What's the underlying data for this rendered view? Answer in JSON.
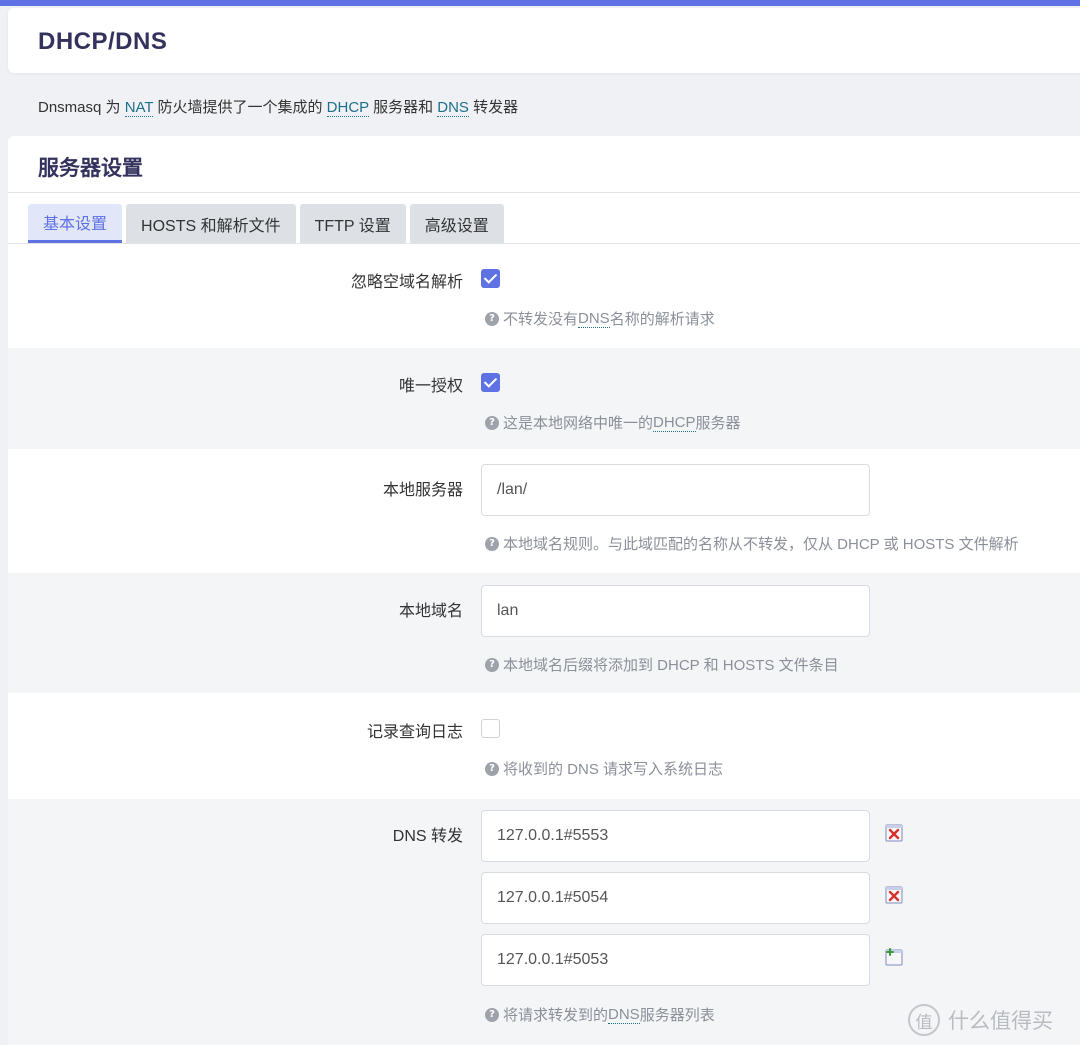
{
  "page": {
    "title": "DHCP/DNS",
    "description": {
      "p1": "Dnsmasq 为 ",
      "a1": "NAT",
      "p2": " 防火墙提供了一个集成的 ",
      "a2": "DHCP",
      "p3": " 服务器和 ",
      "a3": "DNS",
      "p4": " 转发器"
    }
  },
  "section": {
    "title": "服务器设置",
    "tabs": [
      {
        "label": "基本设置",
        "active": true
      },
      {
        "label": "HOSTS 和解析文件",
        "active": false
      },
      {
        "label": "TFTP 设置",
        "active": false
      },
      {
        "label": "高级设置",
        "active": false
      }
    ]
  },
  "fields": {
    "domainneeded": {
      "label": "忽略空域名解析",
      "checked": true,
      "help": {
        "p1": "不转发没有 ",
        "abbr": "DNS",
        "p2": " 名称的解析请求"
      }
    },
    "authoritative": {
      "label": "唯一授权",
      "checked": true,
      "help": {
        "p1": "这是本地网络中唯一的 ",
        "abbr": "DHCP",
        "p2": " 服务器"
      }
    },
    "local": {
      "label": "本地服务器",
      "value": "/lan/",
      "help": "本地域名规则。与此域匹配的名称从不转发，仅从 DHCP 或 HOSTS 文件解析"
    },
    "domain": {
      "label": "本地域名",
      "value": "lan",
      "help": "本地域名后缀将添加到 DHCP 和 HOSTS 文件条目"
    },
    "logqueries": {
      "label": "记录查询日志",
      "checked": false,
      "help": "将收到的 DNS 请求写入系统日志"
    },
    "server": {
      "label": "DNS 转发",
      "entries": [
        "127.0.0.1#5553",
        "127.0.0.1#5054",
        "127.0.0.1#5053"
      ],
      "help": {
        "p1": "将请求转发到的 ",
        "abbr": "DNS",
        "p2": " 服务器列表"
      }
    }
  },
  "icons": {
    "help": "question-circle-icon",
    "remove": "remove-entry-icon",
    "add": "add-entry-icon"
  },
  "watermark": {
    "text": "什么值得买",
    "logo": "值"
  },
  "colors": {
    "accent": "#5e72e4",
    "remove": "#d9302a",
    "add": "#3a9a3a"
  }
}
